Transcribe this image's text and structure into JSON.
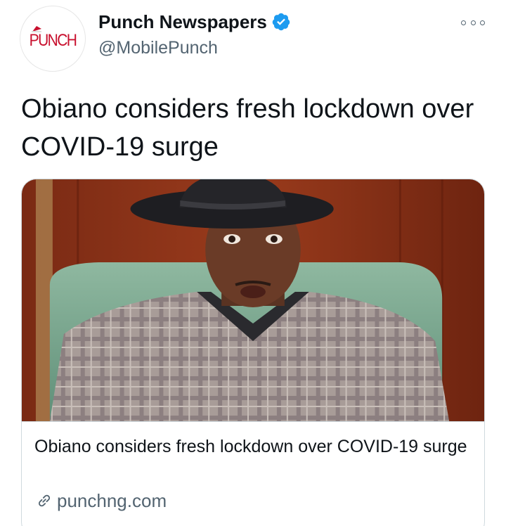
{
  "author": {
    "name": "Punch Newspapers",
    "handle": "@MobilePunch",
    "avatar_text": "PUNCH",
    "verified": true
  },
  "tweet": {
    "text": "Obiano considers fresh lockdown over COVID-19 surge"
  },
  "card": {
    "title": "Obiano considers fresh lockdown over COVID-19 surge",
    "domain": "punchng.com"
  },
  "icons": {
    "verified": "verified-badge-icon",
    "more": "more-options-icon",
    "link": "link-icon"
  },
  "colors": {
    "brand_red": "#c8102e",
    "verified_blue": "#1d9bf0",
    "secondary_text": "#536471",
    "border": "#cfd9de"
  }
}
